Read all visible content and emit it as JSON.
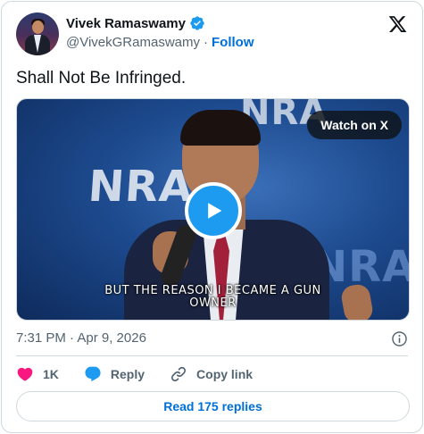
{
  "author": {
    "name": "Vivek Ramaswamy",
    "handle": "@VivekGRamaswamy",
    "separator": "·",
    "follow_label": "Follow"
  },
  "tweet": {
    "text": "Shall Not Be Infringed."
  },
  "media": {
    "watch_label": "Watch on X",
    "caption_line1": "BUT THE REASON I BECAME A GUN",
    "caption_line2": "OWNER",
    "background_text": [
      "NRA",
      "NRA",
      "NRA"
    ]
  },
  "meta": {
    "timestamp": "7:31 PM · Apr 9, 2026"
  },
  "actions": {
    "like_count": "1K",
    "reply_label": "Reply",
    "copy_label": "Copy link"
  },
  "footer": {
    "read_replies_label": "Read 175 replies"
  },
  "icons": {
    "verified": "verified-badge-icon",
    "x_logo": "x-logo-icon",
    "play": "play-icon",
    "info": "info-icon",
    "heart": "heart-icon",
    "reply": "reply-bubble-icon",
    "link": "link-icon"
  },
  "colors": {
    "accent": "#1d9bf0",
    "link": "#006fd6",
    "heart": "#f91880",
    "muted": "#536471",
    "border": "#cfd9de"
  }
}
